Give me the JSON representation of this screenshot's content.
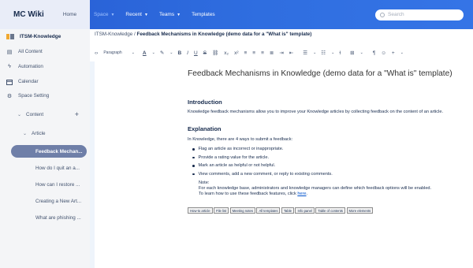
{
  "app": {
    "logo": "MC Wiki",
    "home": "Home"
  },
  "nav": {
    "items": [
      {
        "label": "Space",
        "caret": true,
        "active": true
      },
      {
        "label": "Recent",
        "caret": true
      },
      {
        "label": "Teams",
        "caret": true
      },
      {
        "label": "Templates",
        "caret": false
      }
    ],
    "search_placeholder": "Search"
  },
  "sidebar": {
    "space_title": "ITSM-Knowledge",
    "items": [
      {
        "label": "All Content",
        "icon": "list-icon"
      },
      {
        "label": "Automation",
        "icon": "bolt-icon"
      },
      {
        "label": "Calendar",
        "icon": "calendar-icon"
      },
      {
        "label": "Space Setting",
        "icon": "gear-icon"
      }
    ],
    "content_label": "Content",
    "article_label": "Article",
    "pages": [
      {
        "label": "Feedback Mechan...",
        "active": true
      },
      {
        "label": "How do I quit an a..."
      },
      {
        "label": "How can I restore ..."
      },
      {
        "label": "Creating a New Art..."
      },
      {
        "label": "What are phishing ..."
      }
    ]
  },
  "breadcrumb": {
    "space": "ITSM-Knowledge",
    "separator": " / ",
    "page": "Feedback Mechanisms in Knowledge (demo data for a \"What is\" template)"
  },
  "toolbar": {
    "paragraph": "Paragraph"
  },
  "document": {
    "title": "Feedback Mechanisms in Knowledge (demo data for a \"What is\" template)",
    "intro_heading": "Introduction",
    "intro_text": "Knowledge feedback mechanisms allow you to improve your Knowledge articles by collecting feedback on the content of an article.",
    "explanation_heading": "Explanation",
    "explanation_text": "In Knowledge, there are 4 ways to submit a feedback:",
    "bullets": [
      "Flag an article as incorrect or inappropriate.",
      "Provide a rating value for the article.",
      "Mark an article as helpful or not helpful.",
      "View comments, add a new comment, or reply to existing comments."
    ],
    "note_label": "Note:",
    "note_text": "For each knowledge base, administrators and knowledge managers can define which feedback options will be enabled.",
    "note_link_prefix": "To learn how to use these feedback features, click ",
    "note_link": "here",
    "note_link_suffix": "."
  },
  "template_buttons": [
    "How-to article",
    "File list",
    "Meeting notes",
    "All templates",
    "Table",
    "Info panel",
    "Table of contents",
    "More elements"
  ]
}
